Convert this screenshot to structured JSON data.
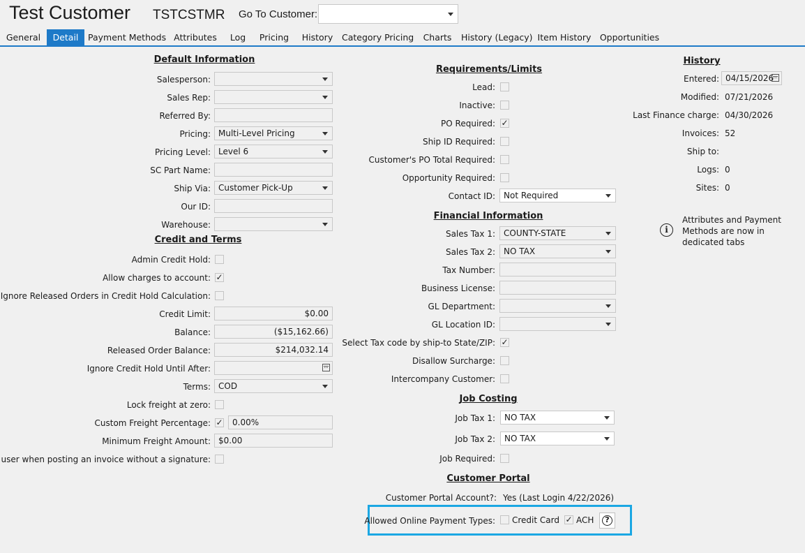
{
  "header": {
    "title": "Test Customer",
    "code": "TSTCSTMR",
    "goto_label": "Go To Customer:",
    "goto_value": ""
  },
  "tabs": [
    "General",
    "Detail",
    "Payment Methods",
    "Attributes",
    "Log",
    "Pricing",
    "History",
    "Category Pricing",
    "Charts",
    "History (Legacy)",
    "Item History",
    "Opportunities"
  ],
  "active_tab": "Detail",
  "default_info": {
    "title": "Default Information",
    "salesperson_label": "Salesperson:",
    "salesperson_value": "",
    "sales_rep_label": "Sales Rep:",
    "sales_rep_value": "",
    "referred_by_label": "Referred By:",
    "referred_by_value": "",
    "pricing_label": "Pricing:",
    "pricing_value": "Multi-Level Pricing",
    "pricing_level_label": "Pricing Level:",
    "pricing_level_value": "Level 6",
    "sc_part_name_label": "SC Part Name:",
    "sc_part_name_value": "",
    "ship_via_label": "Ship Via:",
    "ship_via_value": "Customer Pick-Up",
    "our_id_label": "Our ID:",
    "our_id_value": "",
    "warehouse_label": "Warehouse:",
    "warehouse_value": ""
  },
  "credit": {
    "title": "Credit and Terms",
    "admin_hold_label": "Admin Credit Hold:",
    "admin_hold": false,
    "allow_charges_label": "Allow charges to account:",
    "allow_charges": true,
    "ignore_released_label": "Ignore Released Orders in Credit Hold Calculation:",
    "ignore_released": false,
    "credit_limit_label": "Credit Limit:",
    "credit_limit_value": "$0.00",
    "balance_label": "Balance:",
    "balance_value": "($15,162.66)",
    "released_balance_label": "Released Order Balance:",
    "released_balance_value": "$214,032.14",
    "ignore_until_label": "Ignore Credit Hold Until After:",
    "ignore_until_value": "",
    "terms_label": "Terms:",
    "terms_value": "COD",
    "lock_freight_label": "Lock freight at zero:",
    "lock_freight": false,
    "custom_freight_label": "Custom Freight Percentage:",
    "custom_freight": true,
    "custom_freight_value": "0.00%",
    "min_freight_label": "Minimum Freight Amount:",
    "min_freight_value": "$0.00",
    "warn_signature_label": "Warn user when posting an invoice without a signature:",
    "warn_signature": false
  },
  "requirements": {
    "title": "Requirements/Limits",
    "lead_label": "Lead:",
    "lead": false,
    "inactive_label": "Inactive:",
    "inactive": false,
    "po_required_label": "PO Required:",
    "po_required": true,
    "ship_id_label": "Ship ID Required:",
    "ship_id": false,
    "po_total_label": "Customer's PO Total Required:",
    "po_total": false,
    "opportunity_label": "Opportunity Required:",
    "opportunity": false,
    "contact_id_label": "Contact ID:",
    "contact_id_value": "Not Required"
  },
  "financial": {
    "title": "Financial Information",
    "sales_tax1_label": "Sales Tax 1:",
    "sales_tax1_value": "COUNTY-STATE",
    "sales_tax2_label": "Sales Tax 2:",
    "sales_tax2_value": "NO TAX",
    "tax_number_label": "Tax Number:",
    "tax_number_value": "",
    "business_license_label": "Business License:",
    "business_license_value": "",
    "gl_department_label": "GL Department:",
    "gl_department_value": "",
    "gl_location_label": "GL Location ID:",
    "gl_location_value": "",
    "select_tax_label": "Select Tax code by ship-to State/ZIP:",
    "select_tax": true,
    "disallow_surcharge_label": "Disallow Surcharge:",
    "disallow_surcharge": false,
    "intercompany_label": "Intercompany Customer:",
    "intercompany": false
  },
  "job_costing": {
    "title": "Job Costing",
    "job_tax1_label": "Job Tax 1:",
    "job_tax1_value": "NO TAX",
    "job_tax2_label": "Job Tax 2:",
    "job_tax2_value": "NO TAX",
    "job_required_label": "Job Required:",
    "job_required": false
  },
  "portal": {
    "title": "Customer Portal",
    "account_label": "Customer Portal Account?:",
    "account_value": "Yes (Last Login 4/22/2026)",
    "payment_types_label": "Allowed Online Payment Types:",
    "credit_card_label": "Credit Card",
    "credit_card": false,
    "ach_label": "ACH",
    "ach": true,
    "help_glyph": "?"
  },
  "history": {
    "title": "History",
    "entered_label": "Entered:",
    "entered_value": "04/15/2026",
    "modified_label": "Modified:",
    "modified_value": "07/21/2026",
    "finance_label": "Last Finance charge:",
    "finance_value": "04/30/2026",
    "invoices_label": "Invoices:",
    "invoices_value": "52",
    "ship_to_label": "Ship to:",
    "ship_to_value": "",
    "logs_label": "Logs:",
    "logs_value": "0",
    "sites_label": "Sites:",
    "sites_value": "0",
    "info_note": "Attributes and Payment Methods are now in dedicated tabs",
    "info_glyph": "i"
  },
  "icons": {
    "dropdown": "chevron-down-icon",
    "calendar": "calendar-icon",
    "info": "info-icon",
    "help": "help-icon"
  },
  "colors": {
    "accent": "#1e7ac8",
    "highlight": "#1ba7e3",
    "background": "#f0f0f0"
  }
}
